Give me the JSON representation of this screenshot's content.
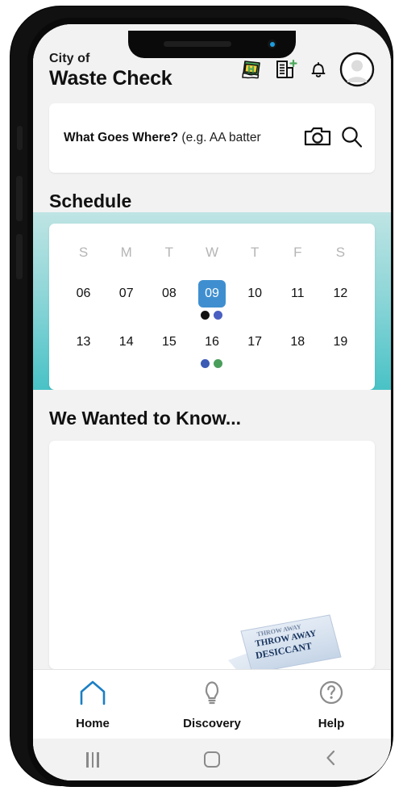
{
  "app": {
    "header": {
      "brand_pre": "City of",
      "brand_main": "Waste Check",
      "icons": [
        {
          "name": "recycle-badge-icon",
          "label": "Waste badge"
        },
        {
          "name": "add-building-icon",
          "label": "Add property"
        },
        {
          "name": "bell-icon",
          "label": "Notifications"
        },
        {
          "name": "avatar-icon",
          "label": "Account"
        }
      ]
    },
    "search": {
      "prompt": "What Goes Where?",
      "placeholder": " (e.g. AA batter",
      "camera_icon": "camera-icon",
      "search_icon": "search-icon"
    },
    "schedule": {
      "title": "Schedule",
      "weekdays": [
        "S",
        "M",
        "T",
        "W",
        "T",
        "F",
        "S"
      ],
      "weeks": [
        [
          {
            "day": "06",
            "selected": false,
            "dots": []
          },
          {
            "day": "07",
            "selected": false,
            "dots": []
          },
          {
            "day": "08",
            "selected": false,
            "dots": []
          },
          {
            "day": "09",
            "selected": true,
            "dots": [
              "#121212",
              "#4a5fc1"
            ]
          },
          {
            "day": "10",
            "selected": false,
            "dots": []
          },
          {
            "day": "11",
            "selected": false,
            "dots": []
          },
          {
            "day": "12",
            "selected": false,
            "dots": []
          }
        ],
        [
          {
            "day": "13",
            "selected": false,
            "dots": []
          },
          {
            "day": "14",
            "selected": false,
            "dots": []
          },
          {
            "day": "15",
            "selected": false,
            "dots": []
          },
          {
            "day": "16",
            "selected": false,
            "dots": [
              "#3b5bb5",
              "#4a9e5c"
            ]
          },
          {
            "day": "17",
            "selected": false,
            "dots": []
          },
          {
            "day": "18",
            "selected": false,
            "dots": []
          },
          {
            "day": "19",
            "selected": false,
            "dots": []
          }
        ]
      ]
    },
    "we_wanted_to_know": {
      "title": "We Wanted to Know...",
      "image_caption_line1": "THROW AWAY",
      "image_caption_line2": "DESICCANT"
    },
    "bottom_nav": [
      {
        "label": "Home",
        "icon": "home-icon",
        "active": true
      },
      {
        "label": "Discovery",
        "icon": "lightbulb-icon",
        "active": false
      },
      {
        "label": "Help",
        "icon": "question-circle-icon",
        "active": false
      }
    ],
    "system_bar": [
      {
        "name": "android-recents-button"
      },
      {
        "name": "android-home-button"
      },
      {
        "name": "android-back-button"
      }
    ],
    "colors": {
      "selected_day": "#3f8fd0",
      "teal_top": "#bfe4e4",
      "teal_bottom": "#45c1c5",
      "active_nav": "#1b7fc4",
      "page_bg": "#f2f2f2"
    }
  }
}
